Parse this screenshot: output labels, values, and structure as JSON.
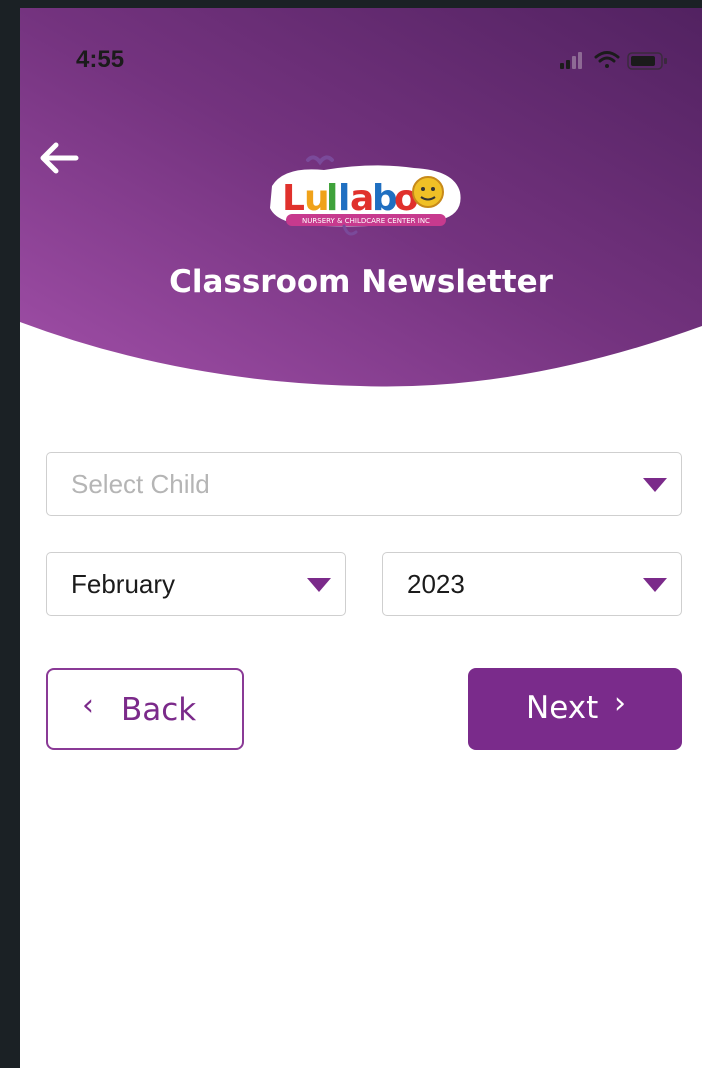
{
  "status_bar": {
    "time": "4:55"
  },
  "header": {
    "logo_name": "Lullaboo",
    "logo_tagline": "NURSERY & CHILDCARE CENTER INC",
    "title": "Classroom Newsletter"
  },
  "form": {
    "child_select": {
      "placeholder": "Select Child"
    },
    "month_select": {
      "value": "February"
    },
    "year_select": {
      "value": "2023"
    }
  },
  "buttons": {
    "back_label": "Back",
    "next_label": "Next"
  },
  "colors": {
    "header_gradient_start": "#a14fa8",
    "header_gradient_end": "#522261",
    "accent": "#7a2b8b",
    "placeholder": "#b5b5b5"
  },
  "icons": [
    "back-arrow-icon",
    "signal-icon",
    "wifi-icon",
    "battery-icon",
    "chevron-left-icon",
    "chevron-right-icon",
    "caret-down-icon"
  ]
}
